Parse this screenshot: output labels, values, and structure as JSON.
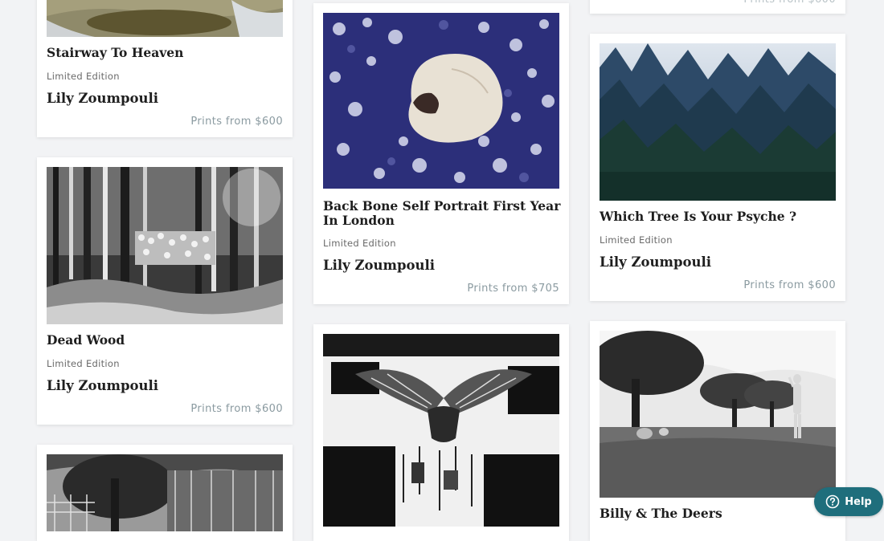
{
  "cards": {
    "stairway": {
      "title": "Stairway To Heaven",
      "edition": "Limited Edition",
      "artist": "Lily Zoumpouli",
      "price": "Prints from $600"
    },
    "backbone": {
      "title": "Back Bone Self Portrait First Year In London",
      "edition": "Limited Edition",
      "artist": "Lily Zoumpouli",
      "price": "Prints from $705"
    },
    "psyche": {
      "title": "Which Tree Is Your Psyche ?",
      "edition": "Limited Edition",
      "artist": "Lily Zoumpouli",
      "price": "Prints from $600"
    },
    "deadwood": {
      "title": "Dead Wood",
      "edition": "Limited Edition",
      "artist": "Lily Zoumpouli",
      "price": "Prints from $600"
    },
    "billy": {
      "title": "Billy & The Deers"
    }
  },
  "help": {
    "label": "Help",
    "icon": "question-circle-icon"
  },
  "colors": {
    "help_bg": "#1f6e7c",
    "price": "#8a9aa0"
  }
}
